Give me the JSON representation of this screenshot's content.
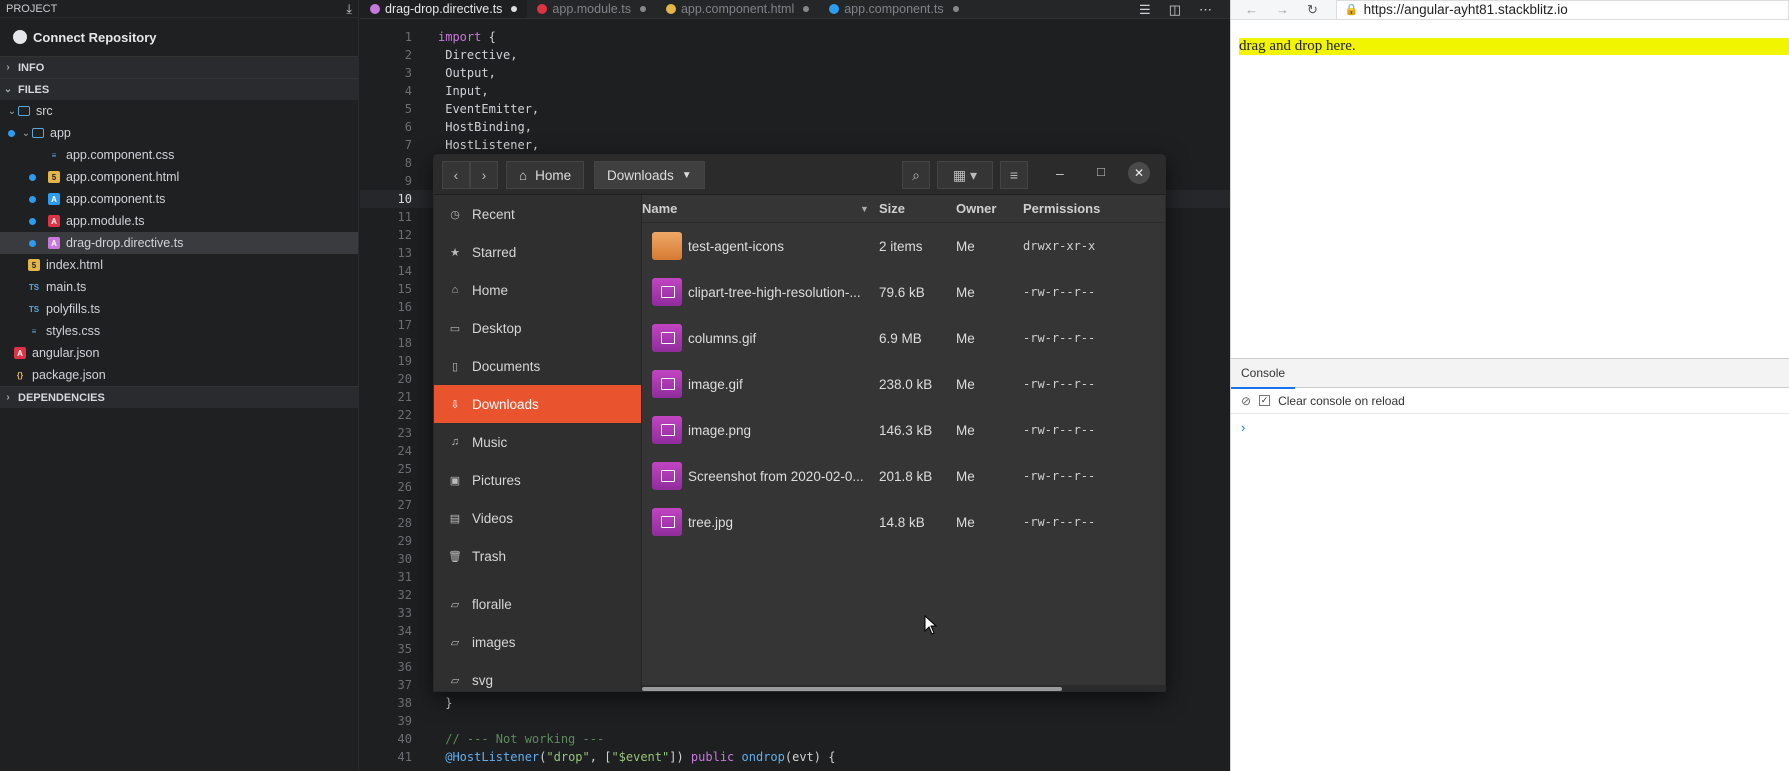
{
  "sidebar": {
    "header": "PROJECT",
    "connect_label": "Connect Repository",
    "sections": {
      "info": "INFO",
      "files": "FILES",
      "dependencies": "DEPENDENCIES"
    },
    "tree": [
      {
        "label": "src",
        "type": "folder",
        "level": 0,
        "open": true,
        "dot": false
      },
      {
        "label": "app",
        "type": "folder",
        "level": 1,
        "open": true,
        "dot": true
      },
      {
        "label": "app.component.css",
        "type": "css",
        "level": 2,
        "dot": false
      },
      {
        "label": "app.component.html",
        "type": "html",
        "level": 2,
        "dot": true
      },
      {
        "label": "app.component.ts",
        "type": "angular",
        "level": 2,
        "dot": true
      },
      {
        "label": "app.module.ts",
        "type": "angular-red",
        "level": 2,
        "dot": true
      },
      {
        "label": "drag-drop.directive.ts",
        "type": "angular-purple",
        "level": 2,
        "dot": true,
        "selected": true
      },
      {
        "label": "index.html",
        "type": "html",
        "level": 1,
        "dot": false
      },
      {
        "label": "main.ts",
        "type": "ts",
        "level": 1,
        "dot": false
      },
      {
        "label": "polyfills.ts",
        "type": "ts",
        "level": 1,
        "dot": false
      },
      {
        "label": "styles.css",
        "type": "css",
        "level": 1,
        "dot": false
      },
      {
        "label": "angular.json",
        "type": "angular-red",
        "level": 0,
        "dot": false
      },
      {
        "label": "package.json",
        "type": "json",
        "level": 0,
        "dot": false
      }
    ]
  },
  "editor": {
    "tabs": [
      {
        "label": "drag-drop.directive.ts",
        "active": true,
        "icon_color": "#c678dd"
      },
      {
        "label": "app.module.ts",
        "active": false,
        "icon_color": "#dd3344"
      },
      {
        "label": "app.component.html",
        "active": false,
        "icon_color": "#e4b54b"
      },
      {
        "label": "app.component.ts",
        "active": false,
        "icon_color": "#2d9bf0"
      }
    ],
    "lines": [
      {
        "n": "1",
        "html": "<span class='kw'>import</span> {"
      },
      {
        "n": "2",
        "html": " Directive,"
      },
      {
        "n": "3",
        "html": " Output,"
      },
      {
        "n": "4",
        "html": " Input,"
      },
      {
        "n": "5",
        "html": " EventEmitter,"
      },
      {
        "n": "6",
        "html": " HostBinding,"
      },
      {
        "n": "7",
        "html": " HostListener,"
      },
      {
        "n": "8",
        "html": ""
      },
      {
        "n": "9",
        "html": ""
      },
      {
        "n": "10",
        "html": "",
        "current": true
      },
      {
        "n": "11",
        "html": ""
      },
      {
        "n": "12",
        "html": ""
      },
      {
        "n": "13",
        "html": ""
      },
      {
        "n": "14",
        "html": ""
      },
      {
        "n": "15",
        "html": ""
      },
      {
        "n": "16",
        "html": ""
      },
      {
        "n": "17",
        "html": ""
      },
      {
        "n": "18",
        "html": ""
      },
      {
        "n": "19",
        "html": ""
      },
      {
        "n": "20",
        "html": ""
      },
      {
        "n": "21",
        "html": ""
      },
      {
        "n": "22",
        "html": ""
      },
      {
        "n": "23",
        "html": ""
      },
      {
        "n": "24",
        "html": ""
      },
      {
        "n": "25",
        "html": ""
      },
      {
        "n": "26",
        "html": ""
      },
      {
        "n": "27",
        "html": ""
      },
      {
        "n": "28",
        "html": ""
      },
      {
        "n": "29",
        "html": ""
      },
      {
        "n": "30",
        "html": ""
      },
      {
        "n": "31",
        "html": ""
      },
      {
        "n": "32",
        "html": ""
      },
      {
        "n": "33",
        "html": ""
      },
      {
        "n": "34",
        "html": ""
      },
      {
        "n": "35",
        "html": ""
      },
      {
        "n": "36",
        "html": ""
      },
      {
        "n": "37",
        "html": ""
      },
      {
        "n": "38",
        "html": " }"
      },
      {
        "n": "39",
        "html": ""
      },
      {
        "n": "40",
        "html": " <span class='cm'>// --- Not working ---</span>"
      },
      {
        "n": "41",
        "html": " <span class='fn'>@HostListener</span>(<span class='st'>\"drop\"</span>, [<span class='st'>\"$event\"</span>]) <span class='kw'>public</span> <span class='fn'>ondrop</span>(evt) {"
      }
    ]
  },
  "browser": {
    "url": "https://angular-ayht81.stackblitz.io",
    "dropzone_text": "drag and drop here.",
    "console_tab": "Console",
    "clear_label": "Clear console on reload",
    "prompt": "›"
  },
  "file_manager": {
    "breadcrumbs": [
      "Home",
      "Downloads"
    ],
    "places": [
      {
        "label": "Recent",
        "icon": "clock-icon",
        "glyph": "◷"
      },
      {
        "label": "Starred",
        "icon": "star-icon",
        "glyph": "★"
      },
      {
        "label": "Home",
        "icon": "home-icon",
        "glyph": "⌂"
      },
      {
        "label": "Desktop",
        "icon": "desktop-icon",
        "glyph": "▭"
      },
      {
        "label": "Documents",
        "icon": "document-icon",
        "glyph": "▯"
      },
      {
        "label": "Downloads",
        "icon": "download-icon",
        "glyph": "⇩",
        "selected": true
      },
      {
        "label": "Music",
        "icon": "music-icon",
        "glyph": "♫"
      },
      {
        "label": "Pictures",
        "icon": "picture-icon",
        "glyph": "▣"
      },
      {
        "label": "Videos",
        "icon": "video-icon",
        "glyph": "▤"
      },
      {
        "label": "Trash",
        "icon": "trash-icon",
        "glyph": "🗑"
      },
      {
        "label": "floralle",
        "icon": "folder-icon",
        "glyph": "▱"
      },
      {
        "label": "images",
        "icon": "folder-icon",
        "glyph": "▱"
      },
      {
        "label": "svg",
        "icon": "folder-icon",
        "glyph": "▱"
      }
    ],
    "columns": {
      "name": "Name",
      "size": "Size",
      "owner": "Owner",
      "permissions": "Permissions"
    },
    "files": [
      {
        "name": "test-agent-icons",
        "size": "2 items",
        "owner": "Me",
        "perm": "drwxr-xr-x",
        "kind": "folder"
      },
      {
        "name": "clipart-tree-high-resolution-...",
        "size": "79.6 kB",
        "owner": "Me",
        "perm": "-rw-r--r--",
        "kind": "img"
      },
      {
        "name": "columns.gif",
        "size": "6.9 MB",
        "owner": "Me",
        "perm": "-rw-r--r--",
        "kind": "img"
      },
      {
        "name": "image.gif",
        "size": "238.0 kB",
        "owner": "Me",
        "perm": "-rw-r--r--",
        "kind": "img"
      },
      {
        "name": "image.png",
        "size": "146.3 kB",
        "owner": "Me",
        "perm": "-rw-r--r--",
        "kind": "img"
      },
      {
        "name": "Screenshot from 2020-02-0...",
        "size": "201.8 kB",
        "owner": "Me",
        "perm": "-rw-r--r--",
        "kind": "img"
      },
      {
        "name": "tree.jpg",
        "size": "14.8 kB",
        "owner": "Me",
        "perm": "-rw-r--r--",
        "kind": "img"
      }
    ]
  }
}
